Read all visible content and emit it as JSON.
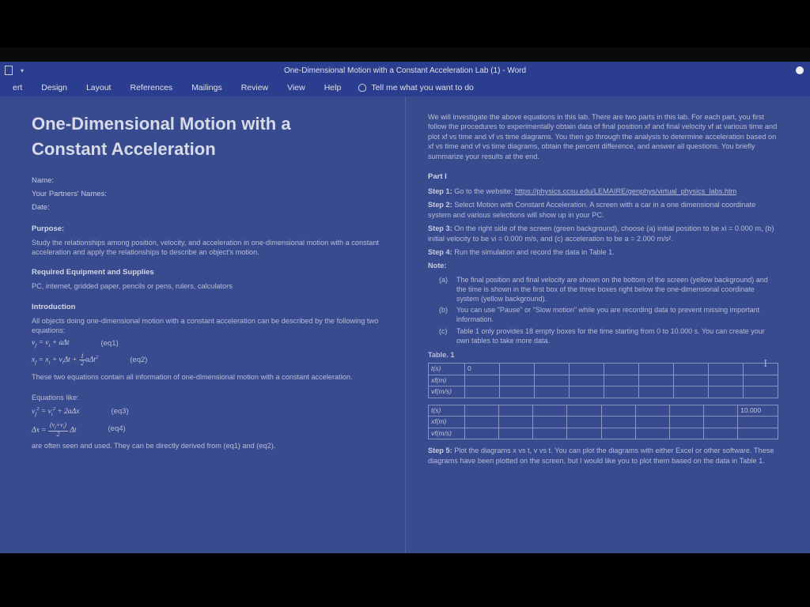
{
  "titlebar": {
    "doc_title": "One-Dimensional Motion with a Constant Acceleration Lab (1)  -  Word"
  },
  "ribbon": {
    "tabs": [
      "ert",
      "Design",
      "Layout",
      "References",
      "Mailings",
      "Review",
      "View",
      "Help"
    ],
    "tell_me": "Tell me what you want to do"
  },
  "left": {
    "title1": "One-Dimensional Motion with a",
    "title2": "Constant Acceleration",
    "name_label": "Name:",
    "partners_label": "Your Partners' Names:",
    "date_label": "Date:",
    "purpose_head": "Purpose:",
    "purpose_body": "Study the relationships among position, velocity, and acceleration in one-dimensional motion with a constant acceleration and apply the relationships to describe an object's motion.",
    "equip_head": "Required Equipment and Supplies",
    "equip_body": "PC, internet, gridded paper, pencils or pens, rulers, calculators",
    "intro_head": "Introduction",
    "intro_body": "All objects doing one-dimensional motion with a constant acceleration can be described by the following two equations:",
    "eq1_label": "(eq1)",
    "eq2_label": "(eq2)",
    "eq_note": "These two equations contain all information of one-dimensional motion with a constant acceleration.",
    "eqlike_head": "Equations like:",
    "eq3_label": "(eq3)",
    "eq4_label": "(eq4)",
    "derive_note": "are often seen and used. They can be directly derived from (eq1) and (eq2)."
  },
  "right": {
    "intro": "We will investigate the above equations in this lab. There are two parts in this lab. For each part, you first follow the procedures to experimentally obtain data of final position xf and final velocity vf at various time and plot xf vs time and vf vs time diagrams. You then go through the analysis to determine acceleration based on xf vs time and vf vs time diagrams, obtain the percent difference, and answer all questions. You briefly summarize your results at the end.",
    "part_head": "Part I",
    "step1_b": "Step 1:",
    "step1": " Go to the website: ",
    "step1_link": "https://physics.ccsu.edu/LEMAIRE/genphys/virtual_physics_labs.htm",
    "step2_b": "Step 2:",
    "step2": " Select Motion with Constant Acceleration. A screen with a car in a one dimensional coordinate system and various selections will show up in your PC.",
    "step3_b": "Step 3:",
    "step3": " On the right side of the screen (green background), choose (a) initial position to be xi = 0.000 m, (b) initial velocity to be vi = 0.000 m/s, and (c) acceleration to be a = 2.000 m/s².",
    "step4_b": "Step 4:",
    "step4": " Run the simulation and record the data in Table 1.",
    "note_head": "Note:",
    "note_a": "The final position and final velocity are shown on the bottom of the screen (yellow background) and the time is shown in the first box of the three boxes right below the one-dimensional coordinate system (yellow background).",
    "note_b": "You can use \"Pause\" or \"Slow motion\" while you are recording data to prevent missing important information.",
    "note_c": "Table 1 only provides 18 empty boxes for the time starting from 0 to 10.000 s. You can create your own tables to take more data.",
    "table_caption": "Table. 1",
    "row_t": "t(s)",
    "row_x": "xf(m)",
    "row_v": "vf(m/s)",
    "t0": "0",
    "t_last": "10.000",
    "step5_b": "Step 5:",
    "step5": " Plot the diagrams x vs t, v vs t. You can plot the diagrams with either Excel or other software. These diagrams have been plotted on the screen, but I would like you to plot them based on the data in Table 1."
  }
}
